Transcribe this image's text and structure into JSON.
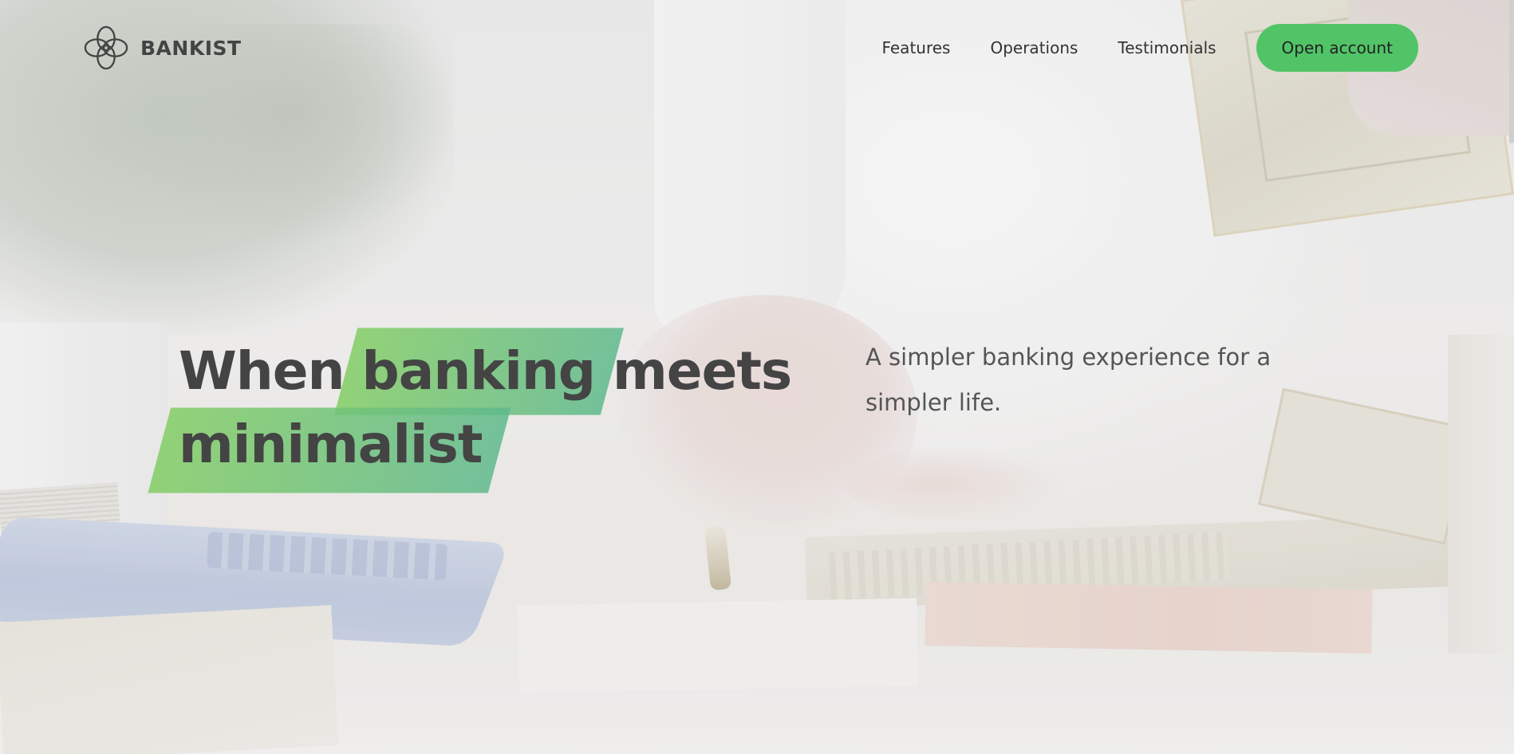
{
  "brand": {
    "name": "BANKIST",
    "logo_icon": "four-petal-flower-icon"
  },
  "nav": {
    "links": [
      "Features",
      "Operations",
      "Testimonials"
    ],
    "cta_label": "Open account"
  },
  "hero": {
    "headline_part1": "When",
    "headline_highlight1": "banking",
    "headline_part2": "meets",
    "headline_highlight2": "minimalist",
    "subtitle": "A simpler banking experience for a simpler life."
  },
  "colors": {
    "accent_green": "#51c467",
    "text_dark": "#444444",
    "highlight_start": "#82cd64",
    "highlight_end": "#5fb98c"
  }
}
